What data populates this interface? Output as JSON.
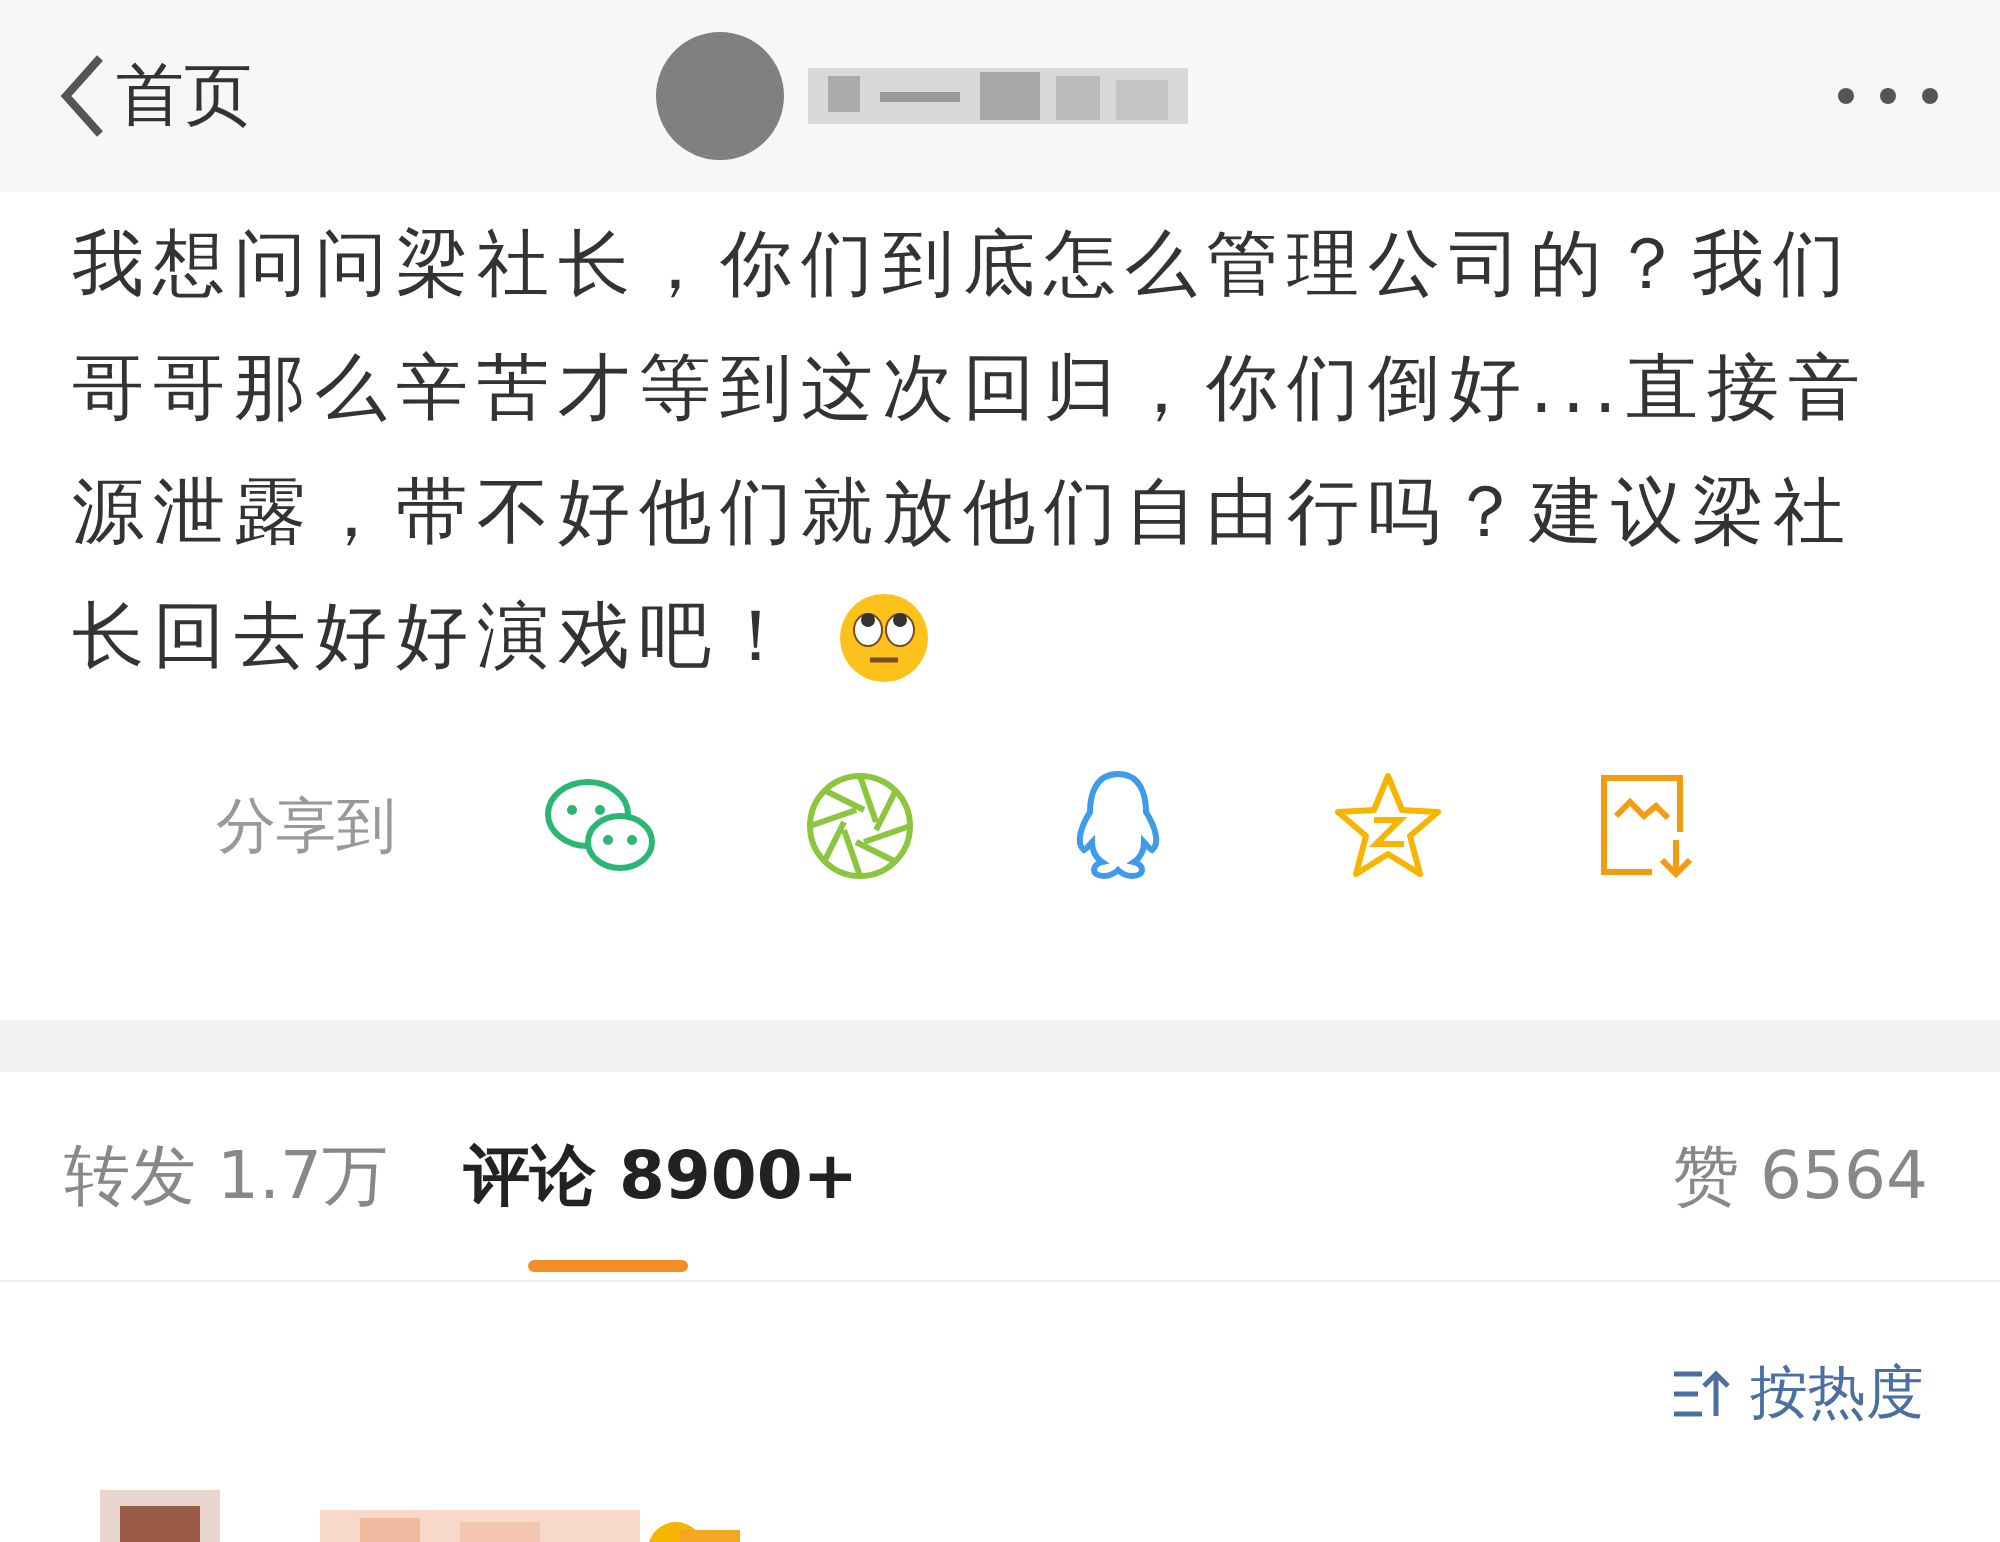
{
  "header": {
    "back_label": "首页"
  },
  "post": {
    "lines": [
      "我想问问梁社长，你们到底怎么管理公司的？我们",
      "哥哥那么辛苦才等到这次回归，你们倒好...直接音",
      "源泄露，带不好他们就放他们自由行吗？建议梁社",
      "长回去好好演戏吧！"
    ]
  },
  "share": {
    "label": "分享到",
    "targets": [
      {
        "kind": "wechat"
      },
      {
        "kind": "moments"
      },
      {
        "kind": "qq"
      },
      {
        "kind": "qzone"
      },
      {
        "kind": "save"
      }
    ]
  },
  "tabs": [
    {
      "label": "转发 1.7万",
      "selected": false
    },
    {
      "label": "评论 8900+",
      "selected": true
    }
  ],
  "likes": "赞 6564",
  "sort": {
    "label": "按热度"
  }
}
